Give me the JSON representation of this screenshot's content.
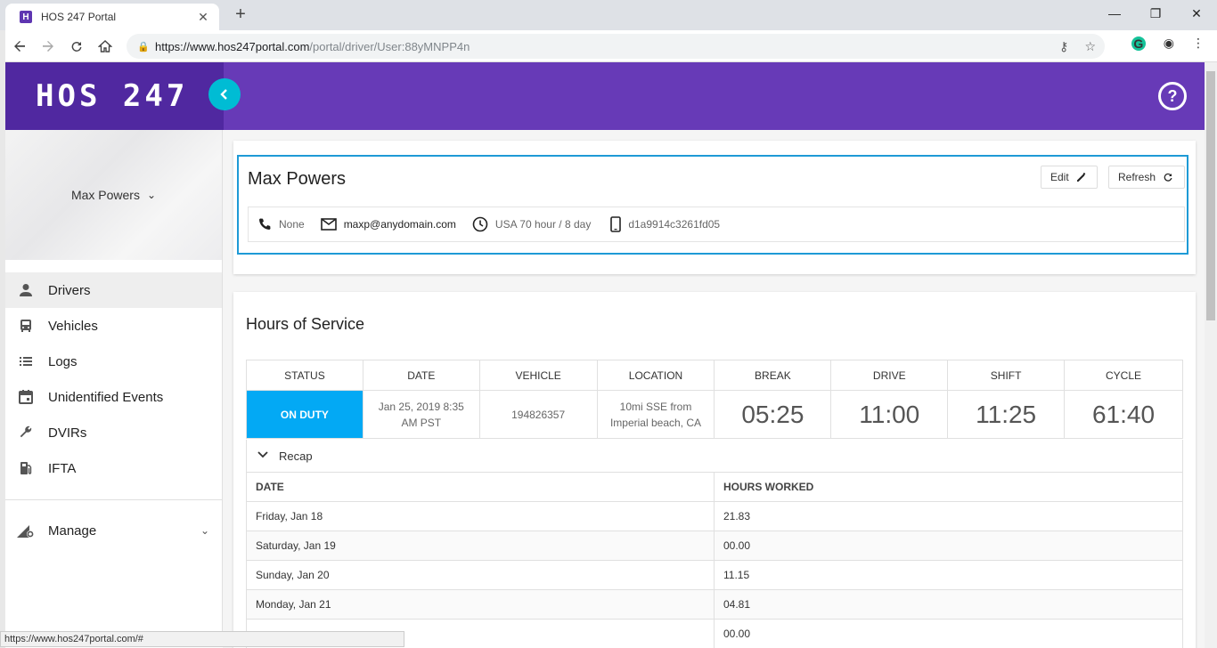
{
  "browser": {
    "tab_title": "HOS 247 Portal",
    "favicon_letter": "H",
    "url_host": "https://www.hos247portal.com",
    "url_path": "/portal/driver/User:88yMNPP4n",
    "status_url": "https://www.hos247portal.com/#"
  },
  "header": {
    "brand": "HOS 247"
  },
  "sidebar": {
    "user_name": "Max Powers",
    "items": [
      {
        "label": "Drivers",
        "icon": "person-icon"
      },
      {
        "label": "Vehicles",
        "icon": "bus-icon"
      },
      {
        "label": "Logs",
        "icon": "list-icon"
      },
      {
        "label": "Unidentified Events",
        "icon": "calendar-icon"
      },
      {
        "label": "DVIRs",
        "icon": "wrench-icon"
      },
      {
        "label": "IFTA",
        "icon": "fuel-icon"
      }
    ],
    "manage_label": "Manage"
  },
  "driver": {
    "name": "Max Powers",
    "edit_label": "Edit",
    "refresh_label": "Refresh",
    "phone": "None",
    "email": "maxp@anydomain.com",
    "cycle_rule": "USA 70 hour / 8 day",
    "device_id": "d1a9914c3261fd05"
  },
  "hos": {
    "title": "Hours of Service",
    "columns": [
      "Status",
      "Date",
      "Vehicle",
      "Location",
      "Break",
      "Drive",
      "Shift",
      "Cycle"
    ],
    "row": {
      "status": "ON DUTY",
      "date": "Jan 25, 2019 8:35 AM PST",
      "vehicle": "194826357",
      "location": "10mi SSE from Imperial beach, CA",
      "break": "05:25",
      "drive": "11:00",
      "shift": "11:25",
      "cycle": "61:40"
    },
    "recap_label": "Recap",
    "recap_columns": [
      "Date",
      "Hours Worked"
    ],
    "recap_rows": [
      {
        "date": "Friday, Jan 18",
        "hours": "21.83"
      },
      {
        "date": "Saturday, Jan 19",
        "hours": "00.00"
      },
      {
        "date": "Sunday, Jan 20",
        "hours": "11.15"
      },
      {
        "date": "Monday, Jan 21",
        "hours": "04.81"
      },
      {
        "date": "",
        "hours": "00.00"
      }
    ]
  },
  "colors": {
    "header_purple": "#673ab7",
    "brand_purple": "#5028a0",
    "accent_cyan": "#00bcd4",
    "status_blue": "#03a9f4",
    "highlight_border": "#1e9ad6"
  }
}
